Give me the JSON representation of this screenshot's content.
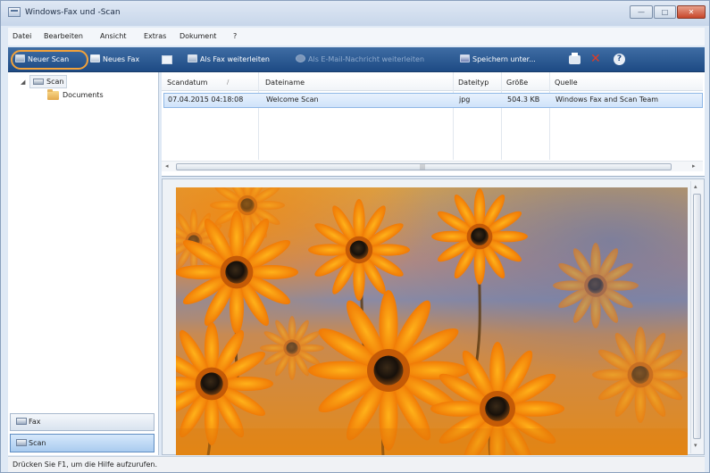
{
  "window": {
    "title": "Windows-Fax und -Scan",
    "controls": {
      "minimize": "—",
      "maximize": "□",
      "close": "✕"
    }
  },
  "menu": [
    "Datei",
    "Bearbeiten",
    "Ansicht",
    "Extras",
    "Dokument",
    "?"
  ],
  "toolbar": {
    "new_scan": "Neuer Scan",
    "new_fax": "Neues Fax",
    "forward_fax": "Als Fax weiterleiten",
    "forward_email": "Als E-Mail-Nachricht weiterleiten",
    "save_as": "Speichern unter...",
    "help": "?",
    "highlight_color": "#f3a23a",
    "icons": [
      "scanner-icon",
      "fax-icon",
      "view-icon",
      "forward-fax-icon",
      "email-icon",
      "save-icon",
      "print-icon",
      "delete-icon",
      "help-icon"
    ]
  },
  "tree": {
    "root": "Scan",
    "children": [
      "Documents"
    ]
  },
  "nav": {
    "fax": "Fax",
    "scan": "Scan"
  },
  "table": {
    "columns": [
      "Scandatum",
      "Dateiname",
      "Dateityp",
      "Größe",
      "Quelle"
    ],
    "sort_indicator": "/",
    "rows": [
      [
        "07.04.2015 04:18:08",
        "Welcome Scan",
        "jpg",
        "504.3 KB",
        "Windows Fax and Scan Team"
      ]
    ]
  },
  "preview": {
    "image_subject": "orange-daisies-photo"
  },
  "status": "Drücken Sie F1, um die Hilfe aufzurufen.",
  "colors": {
    "toolbar": "#1d4a84",
    "selection": "#cfe3fa",
    "close_button": "#c6462a"
  }
}
